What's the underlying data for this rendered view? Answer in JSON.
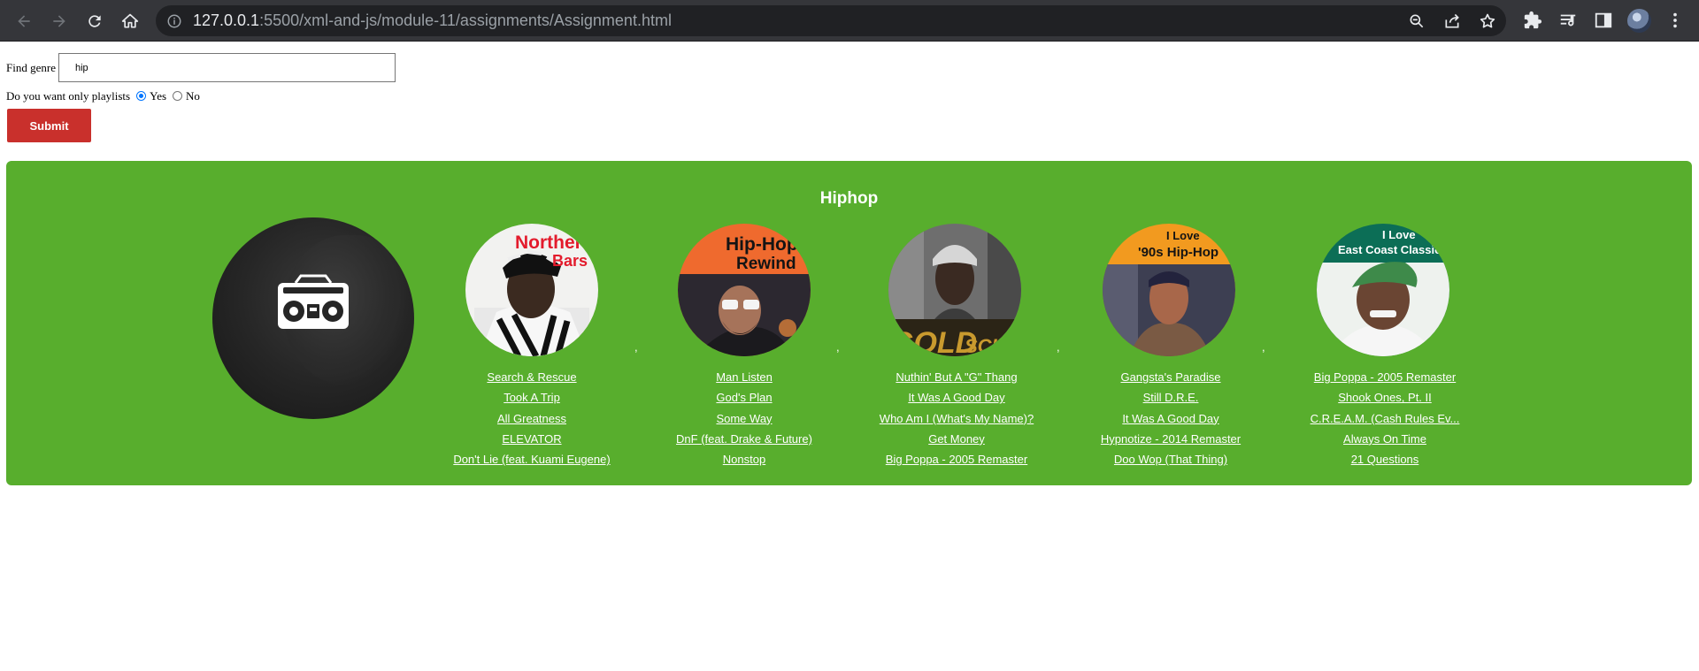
{
  "browser": {
    "url_host": "127.0.0.1",
    "url_rest": ":5500/xml-and-js/module-11/assignments/Assignment.html"
  },
  "form": {
    "find_label": "Find genre",
    "genre_value": "hip",
    "playlists_question": "Do you want only playlists",
    "yes_label": "Yes",
    "no_label": "No",
    "selected": "Yes",
    "submit_label": "Submit"
  },
  "genre": {
    "title": "Hiphop",
    "playlists": [
      {
        "cover_text": [
          "Northern",
          "Bars"
        ],
        "tracks": [
          "Search & Rescue",
          "Took A Trip",
          "All Greatness",
          "ELEVATOR",
          "Don't Lie (feat. Kuami Eugene)"
        ]
      },
      {
        "cover_text": [
          "Hip-Hop",
          "Rewind"
        ],
        "tracks": [
          "Man Listen",
          "God's Plan",
          "Some Way",
          "DnF (feat. Drake & Future)",
          "Nonstop"
        ]
      },
      {
        "cover_text": [
          "GOLD",
          "SCHOOL"
        ],
        "tracks": [
          "Nuthin' But A \"G\" Thang",
          "It Was A Good Day",
          "Who Am I (What's My Name)?",
          "Get Money",
          "Big Poppa - 2005 Remaster"
        ]
      },
      {
        "cover_text": [
          "I Love",
          "'90s Hip-Hop"
        ],
        "tracks": [
          "Gangsta's Paradise",
          "Still D.R.E.",
          "It Was A Good Day",
          "Hypnotize - 2014 Remaster",
          "Doo Wop (That Thing)"
        ]
      },
      {
        "cover_text": [
          "I Love",
          "East Coast Classics"
        ],
        "tracks": [
          "Big Poppa - 2005 Remaster",
          "Shook Ones, Pt. II",
          "C.R.E.A.M. (Cash Rules Ev...",
          "Always On Time",
          "21 Questions"
        ]
      }
    ]
  },
  "colors": {
    "panel_bg": "#58ae2d",
    "submit_bg": "#c9302c",
    "chrome_bg": "#35363a"
  }
}
